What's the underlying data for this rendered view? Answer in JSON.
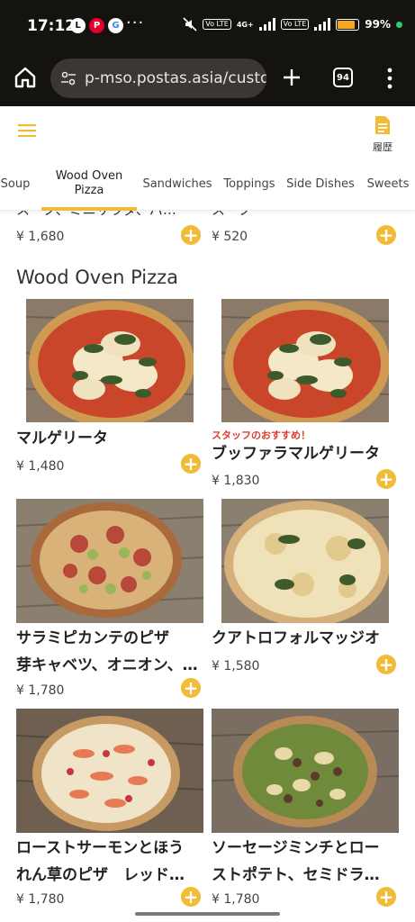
{
  "status_bar": {
    "time": "17:12",
    "apps": [
      "line-icon",
      "paypay-icon",
      "google-icon"
    ],
    "more": "···",
    "network": "4G+",
    "battery": "99%"
  },
  "browser": {
    "url": "p-mso.postas.asia/custo",
    "tab_count": "94"
  },
  "app_header": {
    "history_label": "履歴"
  },
  "categories": [
    {
      "label": "Soup"
    },
    {
      "label": "Wood Oven\nPizza",
      "active": true
    },
    {
      "label": "Sandwiches"
    },
    {
      "label": "Toppings"
    },
    {
      "label": "Side Dishes"
    },
    {
      "label": "Sweets"
    }
  ],
  "previous_section": {
    "items": [
      {
        "name_partial": "スープ、ミニサラダ、パ…",
        "price": "¥ 1,680"
      },
      {
        "name_partial": "スープ",
        "price": "¥ 520"
      }
    ]
  },
  "section": {
    "title": "Wood Oven Pizza",
    "items": [
      {
        "name": "マルゲリータ",
        "price": "¥ 1,480",
        "badge": ""
      },
      {
        "name": "ブッファラマルゲリータ",
        "price": "¥ 1,830",
        "badge": "スタッフのおすすめ！"
      },
      {
        "name_line1": "サラミピカンテのピザ",
        "name_line2": "芽キャベツ、オニオン、…",
        "price": "¥ 1,780"
      },
      {
        "name": "クアトロフォルマッジオ",
        "price": "¥ 1,580"
      },
      {
        "name_line1": "ローストサーモンとほう",
        "name_line2": "れん草のピザ　レッド…",
        "price": "¥ 1,780"
      },
      {
        "name_line1": "ソーセージミンチとロー",
        "name_line2": "ストポテト、セミドラ…",
        "price": "¥ 1,780"
      }
    ]
  },
  "colors": {
    "accent": "#f2bb35",
    "badge_red": "#e03a2e",
    "browser_bg": "#15130f"
  }
}
